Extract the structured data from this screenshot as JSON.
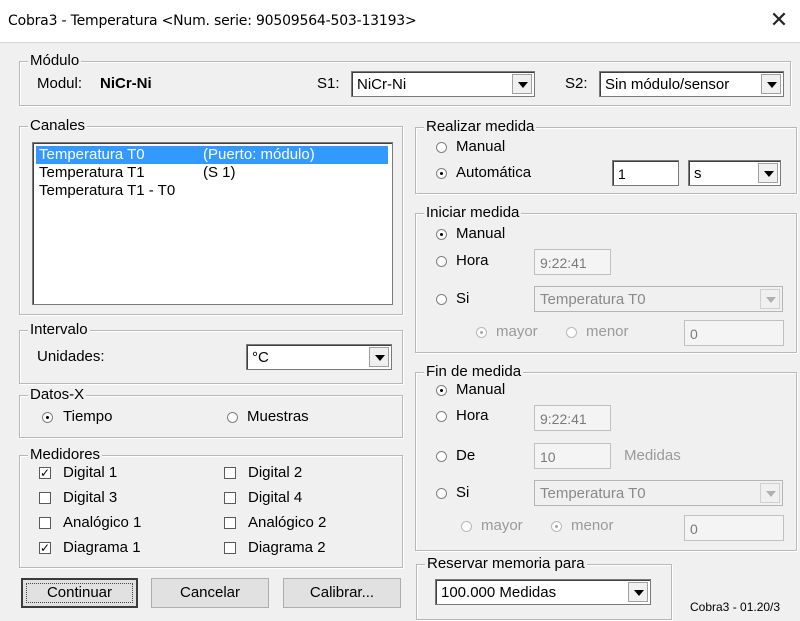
{
  "window": {
    "title": "Cobra3 - Temperatura  <Num. serie: 90509564-503-13193>",
    "close_glyph": "✕"
  },
  "modulo": {
    "legend": "Módulo",
    "modul_label": "Modul:",
    "modul_value": "NiCr-Ni",
    "s1_label": "S1:",
    "s1_value": "NiCr-Ni",
    "s2_label": "S2:",
    "s2_value": "Sin módulo/sensor"
  },
  "canales": {
    "legend": "Canales",
    "items": [
      {
        "name": "Temperatura T0",
        "port": "(Puerto: módulo)",
        "selected": true
      },
      {
        "name": "Temperatura T1",
        "port": "(S 1)",
        "selected": false
      },
      {
        "name": "Temperatura T1 - T0",
        "port": "",
        "selected": false
      }
    ]
  },
  "intervalo": {
    "legend": "Intervalo",
    "unidades_label": "Unidades:",
    "unidades_value": "°C"
  },
  "datos_x": {
    "legend": "Datos-X",
    "options": [
      {
        "label": "Tiempo",
        "checked": true
      },
      {
        "label": "Muestras",
        "checked": false
      }
    ]
  },
  "medidores": {
    "legend": "Medidores",
    "items": [
      {
        "label": "Digital 1",
        "checked": true
      },
      {
        "label": "Digital 2",
        "checked": false
      },
      {
        "label": "Digital 3",
        "checked": false
      },
      {
        "label": "Digital 4",
        "checked": false
      },
      {
        "label": "Analógico 1",
        "checked": false
      },
      {
        "label": "Analógico 2",
        "checked": false
      },
      {
        "label": "Diagrama 1",
        "checked": true
      },
      {
        "label": "Diagrama 2",
        "checked": false
      }
    ]
  },
  "realizar_medida": {
    "legend": "Realizar medida",
    "manual_label": "Manual",
    "automatica_label": "Automática",
    "selected": "Automática",
    "interval_value": "1",
    "unit_value": "s"
  },
  "iniciar_medida": {
    "legend": "Iniciar medida",
    "manual_label": "Manual",
    "hora_label": "Hora",
    "hora_value": "9:22:41",
    "si_label": "Si",
    "si_channel": "Temperatura T0",
    "mayor_label": "mayor",
    "menor_label": "menor",
    "threshold_value": "0",
    "selected": "Manual",
    "cond_selected": "mayor"
  },
  "fin_medida": {
    "legend": "Fin de medida",
    "manual_label": "Manual",
    "hora_label": "Hora",
    "hora_value": "9:22:41",
    "de_label": "De",
    "de_value": "10",
    "medidas_label": "Medidas",
    "si_label": "Si",
    "si_channel": "Temperatura T0",
    "mayor_label": "mayor",
    "menor_label": "menor",
    "threshold_value": "0",
    "selected": "Manual",
    "cond_selected": "menor"
  },
  "reservar": {
    "legend": "Reservar memoria para",
    "value": "100.000 Medidas"
  },
  "buttons": {
    "continuar": "Continuar",
    "cancelar": "Cancelar",
    "calibrar": "Calibrar..."
  },
  "version": "Cobra3 - 01.20/3"
}
